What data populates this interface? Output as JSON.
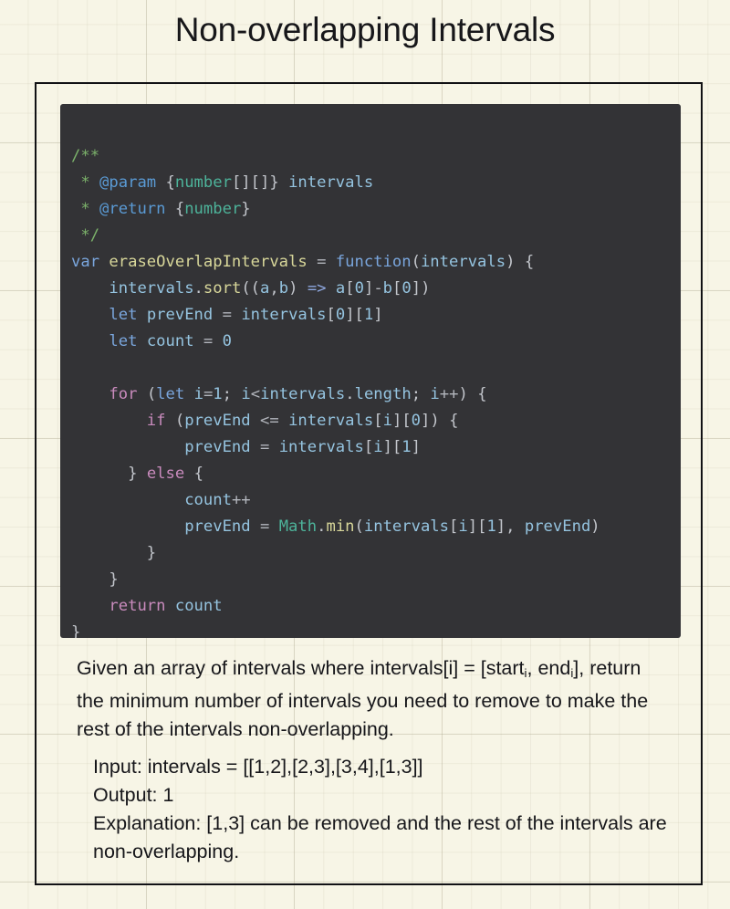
{
  "page": {
    "title": "Non-overlapping Intervals",
    "background_color": "#f7f5e6",
    "grid_color": "#aaa58c",
    "card_border_color": "#111114"
  },
  "code_block": {
    "background_color": "#333336",
    "language": "javascript",
    "colors": {
      "comment": "#7cb36b",
      "jsdoc_tag": "#5a9ad4",
      "type": "#4db39a",
      "keyword": "#c98bbd",
      "declaration_keyword": "#7aa6dd",
      "function_name": "#d8d79a",
      "identifier": "#95c4e0",
      "punctuation": "#c3c6cc",
      "builtin_object": "#4db39a"
    },
    "lines": [
      "/**",
      " * @param {number[][]} intervals",
      " * @return {number}",
      " */",
      "var eraseOverlapIntervals = function(intervals) {",
      "    intervals.sort((a,b) => a[0]-b[0])",
      "    let prevEnd = intervals[0][1]",
      "    let count = 0",
      "",
      "    for (let i=1; i<intervals.length; i++) {",
      "        if (prevEnd <= intervals[i][0]) {",
      "            prevEnd = intervals[i][1]",
      "      } else {",
      "            count++",
      "            prevEnd = Math.min(intervals[i][1], prevEnd)",
      "        }",
      "    }",
      "    return count",
      "}"
    ]
  },
  "description": {
    "part1": "Given an array of intervals where intervals[i] = [start",
    "sub1": "i",
    "part2": ", end",
    "sub2": "i",
    "part3": "], return the minimum number of intervals you need to remove to make the rest of the intervals non-overlapping."
  },
  "example": {
    "input_line": "Input: intervals = [[1,2],[2,3],[3,4],[1,3]]",
    "output_line": "Output: 1",
    "explanation_line": "Explanation: [1,3] can be removed and the rest of the intervals are non-overlapping."
  }
}
